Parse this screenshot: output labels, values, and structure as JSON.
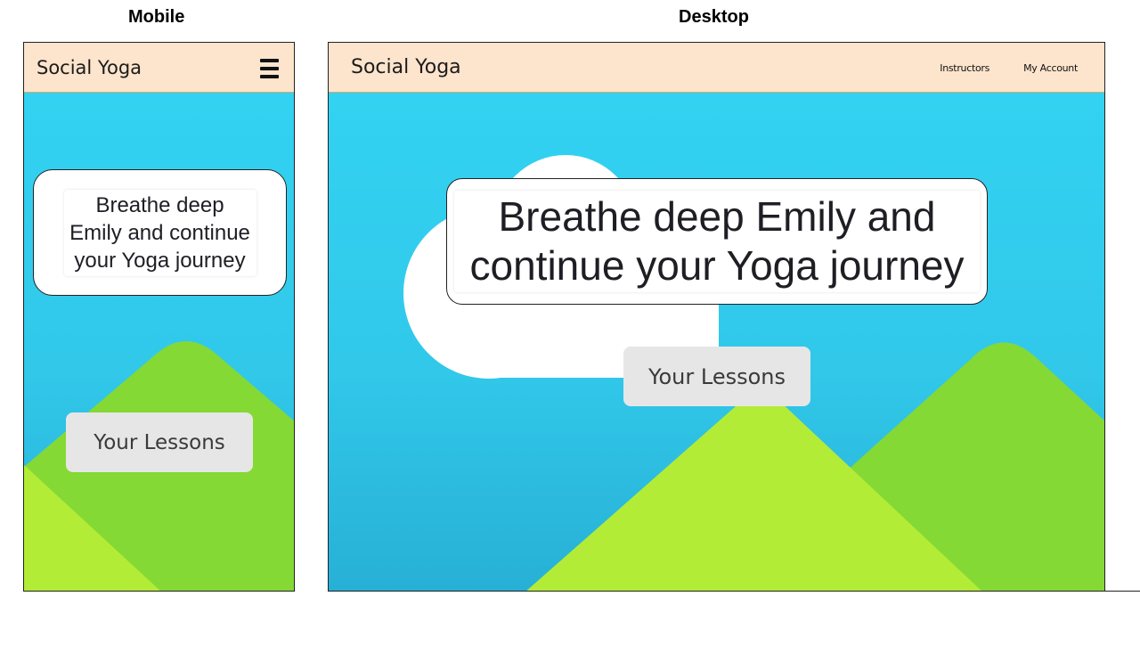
{
  "labels": {
    "mobile": "Mobile",
    "desktop": "Desktop"
  },
  "app": {
    "brand": "Social Yoga"
  },
  "mobile": {
    "menu_icon": "hamburger-menu-icon",
    "message_lines": [
      "Breathe deep",
      "Emily and continue",
      "your Yoga journey"
    ],
    "lessons_button": "Your Lessons"
  },
  "desktop": {
    "nav": [
      "Instructors",
      "My Account"
    ],
    "message_lines": [
      "Breathe deep Emily and",
      "continue your Yoga journey"
    ],
    "lessons_button": "Your Lessons"
  },
  "colors": {
    "header_bg": "#fde4cc",
    "sky": "#33d4f3",
    "mountain_dark": "#85d934",
    "mountain_light": "#b3ec36",
    "cloud": "#ffffff",
    "button_bg": "#e6e6e6"
  }
}
